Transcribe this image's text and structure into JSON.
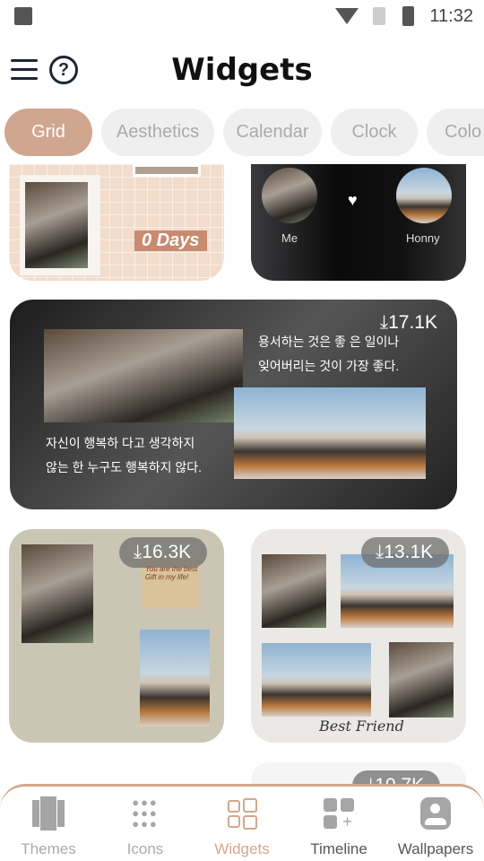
{
  "status_bar": {
    "time": "11:32"
  },
  "header": {
    "title": "Widgets"
  },
  "categories": [
    {
      "label": "Grid",
      "active": true
    },
    {
      "label": "Aesthetics"
    },
    {
      "label": "Calendar"
    },
    {
      "label": "Clock"
    },
    {
      "label": "Colo"
    }
  ],
  "widgets": {
    "days_counter": {
      "text": "0 Days"
    },
    "couple": {
      "left_name": "Me",
      "right_name": "Honny"
    },
    "quote": {
      "downloads": "17.1K",
      "quote_top": "용서하는 것은 좋 은 일이나\n잊어버리는 것이 가장 좋다.",
      "quote_bottom": "자신이 행복하 다고 생각하지\n않는 한 누구도 행복하지 않다."
    },
    "gift": {
      "downloads": "16.3K",
      "note": "You are the best\nGift in my life!"
    },
    "best_friend": {
      "downloads": "13.1K",
      "caption": "Best Friend"
    },
    "next": {
      "downloads": "10.7K"
    }
  },
  "accent_color": "#cfa690",
  "bottom_nav": [
    {
      "label": "Themes",
      "icon": "themes-icon"
    },
    {
      "label": "Icons",
      "icon": "icons-grid-icon"
    },
    {
      "label": "Widgets",
      "icon": "widgets-icon",
      "active": true
    },
    {
      "label": "Timeline",
      "icon": "timeline-icon"
    },
    {
      "label": "Wallpapers",
      "icon": "wallpapers-icon"
    }
  ]
}
